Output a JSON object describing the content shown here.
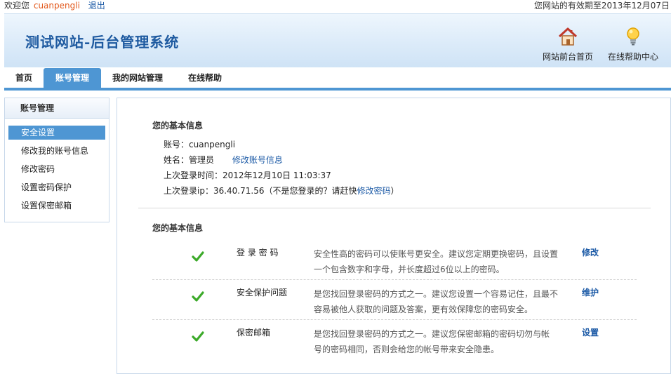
{
  "topbar": {
    "welcome": "欢迎您",
    "username": "cuanpengli",
    "logout": "退出",
    "validity": "您网站的有效期至2013年12月07日"
  },
  "header": {
    "title": "测试网站-后台管理系统",
    "home_link": "网站前台首页",
    "help_link": "在线帮助中心"
  },
  "nav": {
    "tabs": [
      {
        "label": "首页"
      },
      {
        "label": "账号管理"
      },
      {
        "label": "我的网站管理"
      },
      {
        "label": "在线帮助"
      }
    ]
  },
  "sidebar": {
    "title": "账号管理",
    "items": [
      {
        "label": "安全设置"
      },
      {
        "label": "修改我的账号信息"
      },
      {
        "label": "修改密码"
      },
      {
        "label": "设置密码保护"
      },
      {
        "label": "设置保密邮箱"
      }
    ]
  },
  "basic_info": {
    "title": "您的基本信息",
    "account_label": "账号：",
    "account_value": "cuanpengli",
    "name_label": "姓名：",
    "name_value": "管理员",
    "edit_link": "修改账号信息",
    "last_login_label": "上次登录时间：",
    "last_login_value": "2012年12月10日 11:03:37",
    "last_ip_label": "上次登录ip：",
    "last_ip_value": "36.40.71.56",
    "ip_note_pre": "（不是您登录的？请赶快",
    "ip_note_link": "修改密码",
    "ip_note_post": "）"
  },
  "security": {
    "title": "您的基本信息",
    "rows": [
      {
        "name": "登 录 密 码",
        "desc": "安全性高的密码可以使账号更安全。建议您定期更换密码，且设置一个包含数字和字母，并长度超过6位以上的密码。",
        "action": "修改"
      },
      {
        "name": "安全保护问题",
        "desc": "是您找回登录密码的方式之一。建议您设置一个容易记住，且最不容易被他人获取的问题及答案，更有效保障您的密码安全。",
        "action": "维护"
      },
      {
        "name": "保密邮箱",
        "desc": "是您找回登录密码的方式之一。建议您保密邮箱的密码切勿与帐 号的密码相同，否则会给您的帐号带来安全隐患。",
        "action": "设置"
      }
    ]
  },
  "colors": {
    "accent": "#4e96d3",
    "link": "#1c5aa6",
    "username": "#e2581b",
    "check": "#3caa2a"
  },
  "icons": {
    "home": "home-icon",
    "help": "lightbulb-icon",
    "check": "check-icon"
  }
}
